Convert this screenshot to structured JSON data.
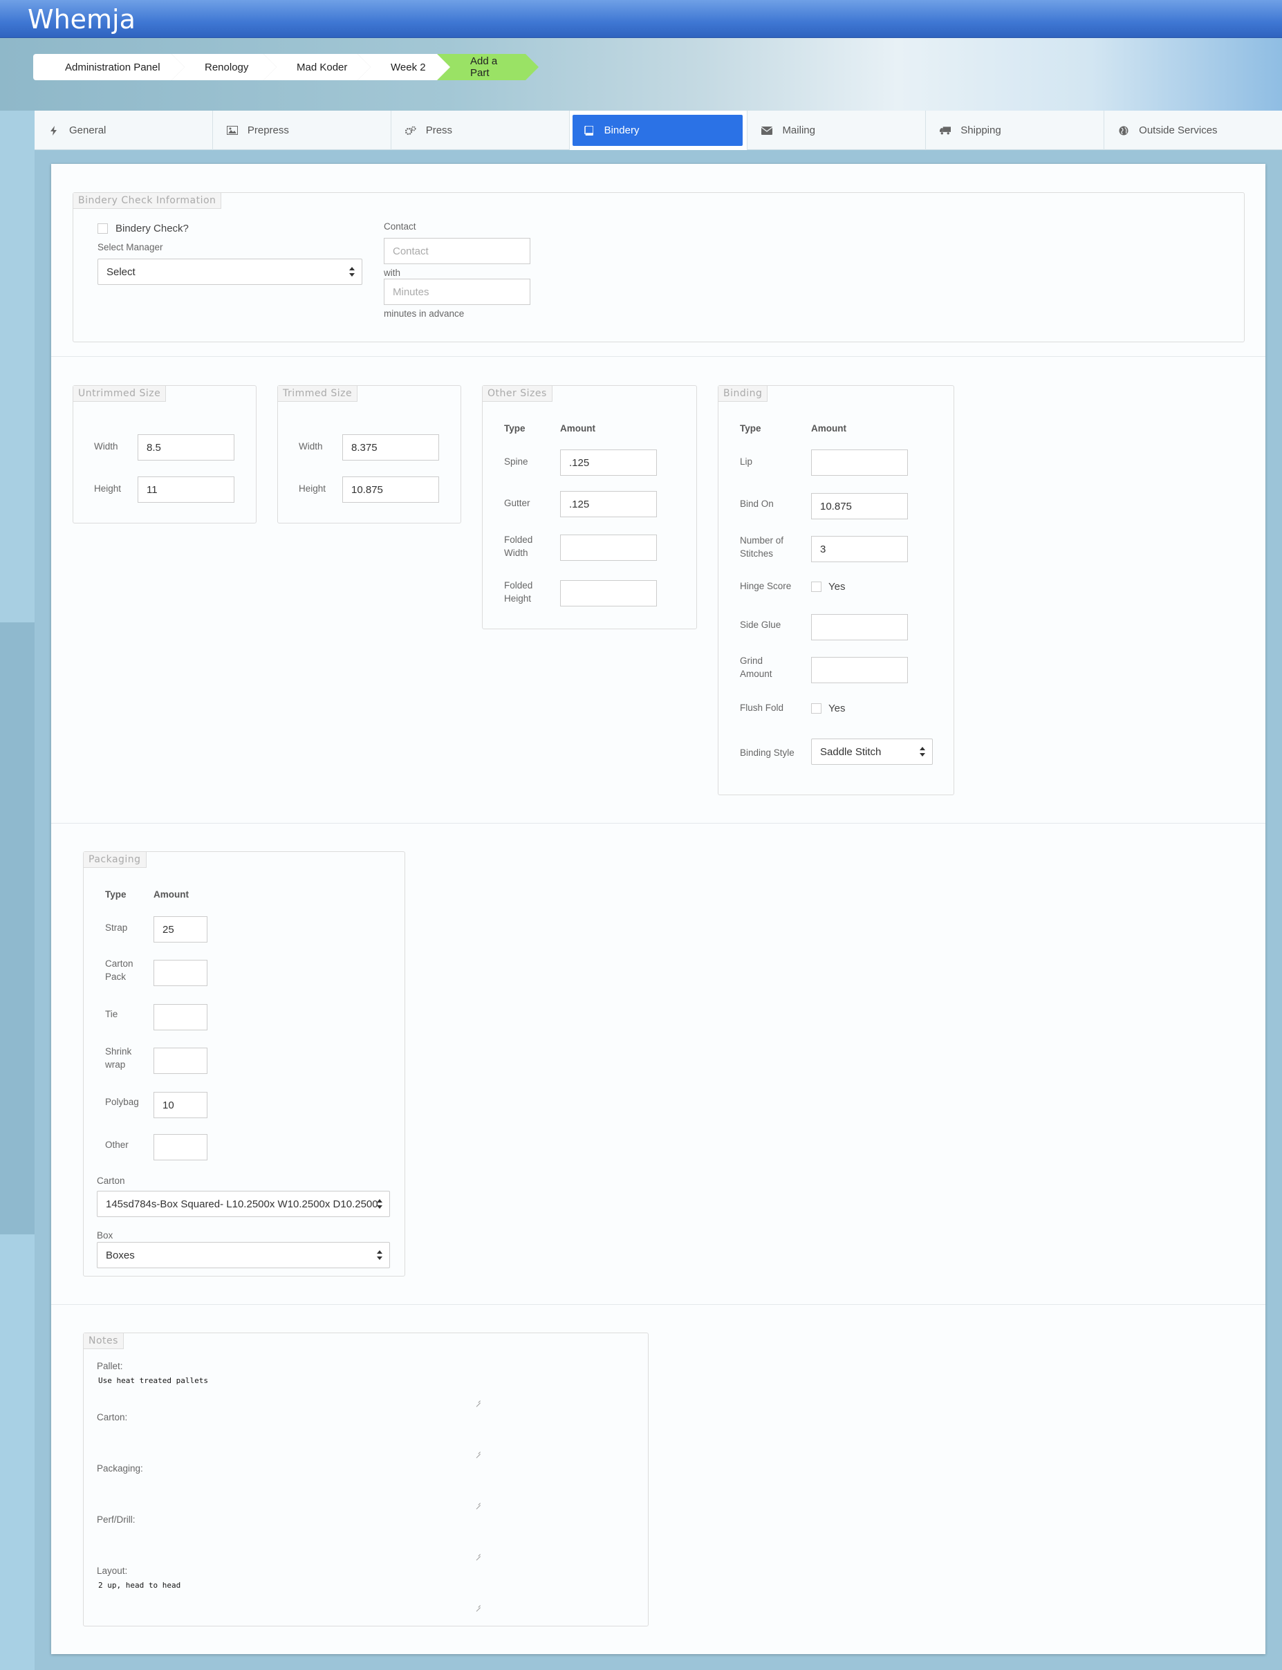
{
  "app": {
    "logo": "Whemja"
  },
  "breadcrumb": [
    "Administration Panel",
    "Renology",
    "Mad Koder",
    "Week 2",
    "Add a Part"
  ],
  "tabs": [
    {
      "label": "General",
      "icon": "bolt-icon"
    },
    {
      "label": "Prepress",
      "icon": "image-icon"
    },
    {
      "label": "Press",
      "icon": "gears-icon"
    },
    {
      "label": "Bindery",
      "icon": "book-icon",
      "active": true
    },
    {
      "label": "Mailing",
      "icon": "envelope-icon"
    },
    {
      "label": "Shipping",
      "icon": "truck-icon"
    },
    {
      "label": "Outside Services",
      "icon": "globe-icon"
    }
  ],
  "bindery_check": {
    "legend": "Bindery Check Information",
    "checkbox_label": "Bindery Check?",
    "manager_label": "Select Manager",
    "manager_value": "Select",
    "contact_label": "Contact",
    "contact_placeholder": "Contact",
    "with_label": "with",
    "minutes_placeholder": "Minutes",
    "advance_label": "minutes in advance"
  },
  "untrimmed": {
    "legend": "Untrimmed Size",
    "width_label": "Width",
    "width": "8.5",
    "height_label": "Height",
    "height": "11"
  },
  "trimmed": {
    "legend": "Trimmed Size",
    "width_label": "Width",
    "width": "8.375",
    "height_label": "Height",
    "height": "10.875"
  },
  "other_sizes": {
    "legend": "Other Sizes",
    "col_type": "Type",
    "col_amount": "Amount",
    "rows": [
      {
        "label": "Spine",
        "value": ".125"
      },
      {
        "label": "Gutter",
        "value": ".125"
      },
      {
        "label": "Folded\nWidth",
        "value": ""
      },
      {
        "label": "Folded\nHeight",
        "value": ""
      }
    ]
  },
  "binding": {
    "legend": "Binding",
    "col_type": "Type",
    "col_amount": "Amount",
    "lip_label": "Lip",
    "lip": "",
    "bind_on_label": "Bind On",
    "bind_on": "10.875",
    "stitches_label": "Number of\nStitches",
    "stitches": "3",
    "hinge_label": "Hinge Score",
    "hinge_yes": "Yes",
    "side_glue_label": "Side Glue",
    "side_glue": "",
    "grind_label": "Grind\nAmount",
    "grind": "",
    "flush_label": "Flush Fold",
    "flush_yes": "Yes",
    "style_label": "Binding Style",
    "style": "Saddle Stitch"
  },
  "packaging": {
    "legend": "Packaging",
    "col_type": "Type",
    "col_amount": "Amount",
    "rows": [
      {
        "label": "Strap",
        "value": "25"
      },
      {
        "label": "Carton\nPack",
        "value": ""
      },
      {
        "label": "Tie",
        "value": ""
      },
      {
        "label": "Shrink\nwrap",
        "value": ""
      },
      {
        "label": "Polybag",
        "value": "10"
      },
      {
        "label": "Other",
        "value": ""
      }
    ],
    "carton_label": "Carton",
    "carton_value": "145sd784s-Box Squared- L10.2500x W10.2500x D10.2500",
    "box_label": "Box",
    "box_value": "Boxes"
  },
  "notes": {
    "legend": "Notes",
    "pallet_label": "Pallet:",
    "pallet": "Use heat treated pallets",
    "carton_label": "Carton:",
    "carton": "",
    "packaging_label": "Packaging:",
    "packaging": "",
    "perf_label": "Perf/Drill:",
    "perf": "",
    "layout_label": "Layout:",
    "layout": "2 up, head to head"
  }
}
